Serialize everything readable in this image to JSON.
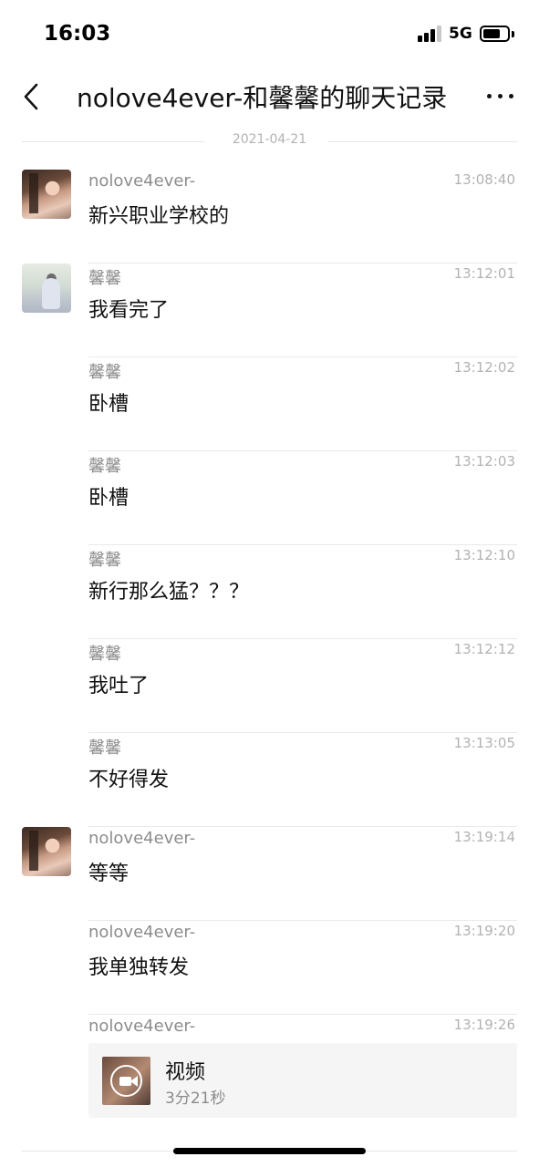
{
  "status_bar": {
    "time": "16:03",
    "network": "5G",
    "signal_bars": 3
  },
  "nav": {
    "title": "nolove4ever-和馨馨的聊天记录"
  },
  "date_divider": "2021-04-21",
  "messages": [
    {
      "sender": "nolove4ever-",
      "time": "13:08:40",
      "text": "新兴职业学校的"
    },
    {
      "sender": "馨馨",
      "time": "13:12:01",
      "text": "我看完了"
    },
    {
      "sender": "馨馨",
      "time": "13:12:02",
      "text": "卧槽"
    },
    {
      "sender": "馨馨",
      "time": "13:12:03",
      "text": "卧槽"
    },
    {
      "sender": "馨馨",
      "time": "13:12:10",
      "text": "新行那么猛？？？"
    },
    {
      "sender": "馨馨",
      "time": "13:12:12",
      "text": "我吐了"
    },
    {
      "sender": "馨馨",
      "time": "13:13:05",
      "text": "不好得发"
    },
    {
      "sender": "nolove4ever-",
      "time": "13:19:14",
      "text": "等等"
    },
    {
      "sender": "nolove4ever-",
      "time": "13:19:20",
      "text": "我单独转发"
    },
    {
      "sender": "nolove4ever-",
      "time": "13:19:26",
      "video": {
        "title": "视频",
        "duration": "3分21秒"
      }
    }
  ]
}
